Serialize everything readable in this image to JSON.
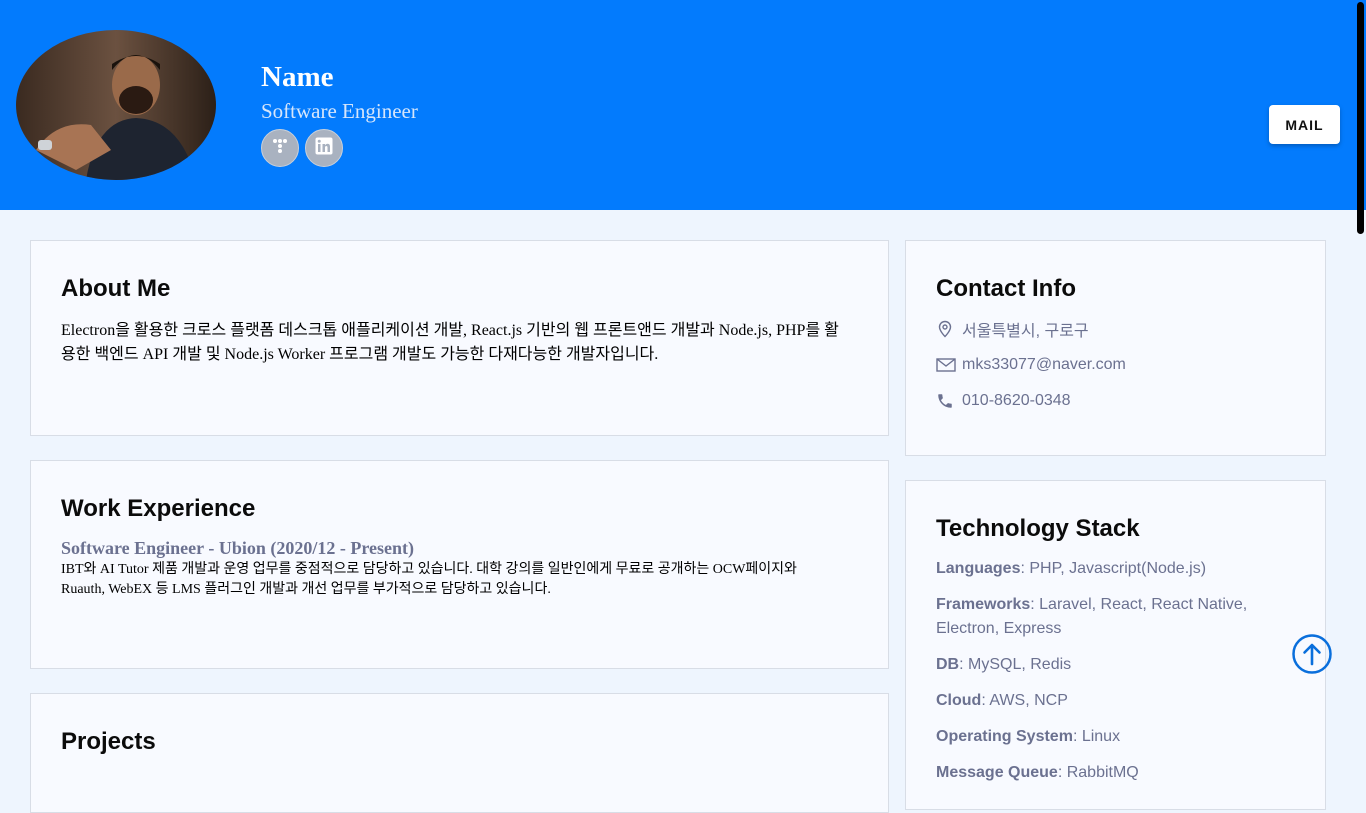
{
  "header": {
    "name": "Name",
    "role": "Software Engineer",
    "social": [
      {
        "icon": "tistory-icon"
      },
      {
        "icon": "linkedin-icon"
      }
    ],
    "mail_button": "MAIL"
  },
  "about": {
    "title": "About Me",
    "text": "Electron을 활용한 크로스 플랫폼 데스크톱 애플리케이션 개발, React.js 기반의 웹 프론트앤드 개발과 Node.js, PHP를 활용한 백엔드 API 개발 및 Node.js Worker 프로그램 개발도 가능한 다재다능한 개발자입니다."
  },
  "work": {
    "title": "Work Experience",
    "job_title": "Software Engineer - Ubion (2020/12 - Present)",
    "job_desc": "IBT와 AI Tutor 제품 개발과 운영 업무를 중점적으로 담당하고 있습니다. 대학 강의를 일반인에게 무료로 공개하는 OCW페이지와 Ruauth, WebEX 등 LMS 플러그인 개발과 개선 업무를 부가적으로 담당하고 있습니다."
  },
  "projects": {
    "title": "Projects"
  },
  "contact": {
    "title": "Contact Info",
    "address": "서울특별시, 구로구",
    "email": "mks33077@naver.com",
    "phone": "010-8620-0348"
  },
  "tech": {
    "title": "Technology Stack",
    "items": [
      {
        "label": "Languages",
        "value": ": PHP, Javascript(Node.js)"
      },
      {
        "label": "Frameworks",
        "value": ": Laravel, React, React Native, Electron, Express"
      },
      {
        "label": "DB",
        "value": ": MySQL, Redis"
      },
      {
        "label": "Cloud",
        "value": ": AWS, NCP"
      },
      {
        "label": "Operating System",
        "value": ": Linux"
      },
      {
        "label": "Message Queue",
        "value": ": RabbitMQ"
      }
    ]
  },
  "colors": {
    "header_bg": "#037bfd",
    "page_bg": "#eef5fe",
    "card_bg": "#f8faff",
    "muted_text": "#6b7190",
    "accent": "#0a6fdc"
  }
}
